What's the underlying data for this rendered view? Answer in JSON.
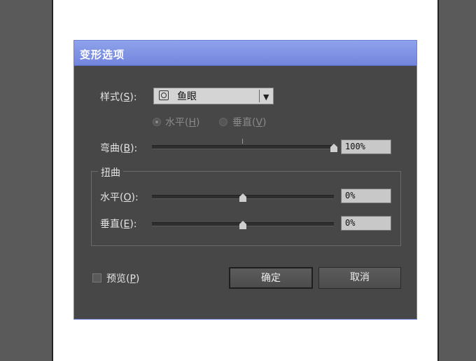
{
  "dialog": {
    "title": "变形选项",
    "style_label_pre": "样式(",
    "style_label_key": "S",
    "style_label_post": "):",
    "style_value": "鱼眼",
    "orientation": {
      "horizontal": {
        "pre": "水平(",
        "key": "H",
        "post": ")",
        "selected": true
      },
      "vertical": {
        "pre": "垂直(",
        "key": "V",
        "post": ")",
        "selected": false
      }
    },
    "bend": {
      "pre": "弯曲(",
      "key": "B",
      "post": "):",
      "value": "100%",
      "level": 1.0
    },
    "distortion": {
      "title": "扭曲",
      "horizontal": {
        "pre": "水平(",
        "key": "O",
        "post": "):",
        "value": "0%",
        "level": 0.5
      },
      "vertical": {
        "pre": "垂直(",
        "key": "E",
        "post": "):",
        "value": "0%",
        "level": 0.5
      }
    },
    "preview": {
      "pre": "预览(",
      "key": "P",
      "post": ")",
      "checked": false
    },
    "ok_label": "确定",
    "cancel_label": "取消"
  },
  "colors": {
    "titlebar": "#7f92e4",
    "dialog_bg": "#474747",
    "border": "#6e80d8"
  },
  "icons": {
    "style_icon": "fisheye-style-icon",
    "dropdown": "chevron-down-icon"
  }
}
